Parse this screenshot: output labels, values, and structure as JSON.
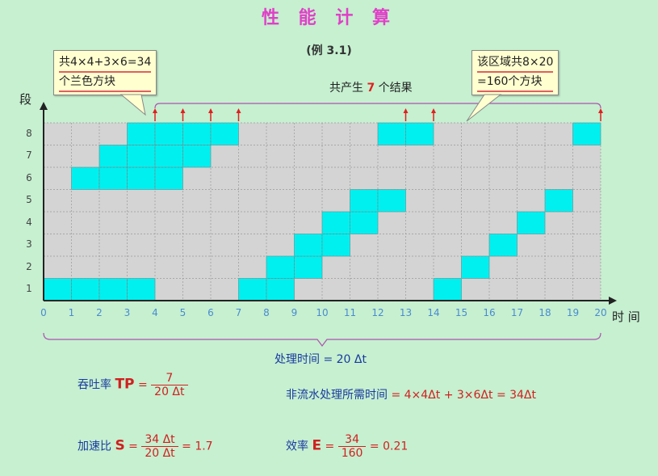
{
  "title": "性 能 计 算",
  "subtitle": "(例 3.1)",
  "callout_left": {
    "line1": "共4×4+3×6=34",
    "line2": "个兰色方块"
  },
  "callout_right": {
    "line1": "该区域共8×20",
    "line2": "=160个方块"
  },
  "results_label": {
    "prefix": "共产生 ",
    "count": "7",
    "suffix": " 个结果"
  },
  "y_axis_label": "段",
  "x_axis_label": "时 间",
  "processing_time": "处理时间 = 20 Δt",
  "colors": {
    "background": "#c6f0d0",
    "block": "#00f0f0",
    "cell": "#d4d4d4",
    "arrow": "#e02020",
    "title": "#e040c8"
  },
  "chart_data": {
    "type": "heatmap",
    "x_ticks": [
      "0",
      "1",
      "2",
      "3",
      "4",
      "5",
      "6",
      "7",
      "8",
      "9",
      "10",
      "11",
      "12",
      "13",
      "14",
      "15",
      "16",
      "17",
      "18",
      "19",
      "20"
    ],
    "y_ticks": [
      "1",
      "2",
      "3",
      "4",
      "5",
      "6",
      "7",
      "8"
    ],
    "blocks": [
      {
        "segment": 1,
        "time": 0
      },
      {
        "segment": 1,
        "time": 1
      },
      {
        "segment": 1,
        "time": 2
      },
      {
        "segment": 1,
        "time": 3
      },
      {
        "segment": 6,
        "time": 1
      },
      {
        "segment": 6,
        "time": 2
      },
      {
        "segment": 6,
        "time": 3
      },
      {
        "segment": 6,
        "time": 4
      },
      {
        "segment": 7,
        "time": 2
      },
      {
        "segment": 7,
        "time": 3
      },
      {
        "segment": 7,
        "time": 4
      },
      {
        "segment": 7,
        "time": 5
      },
      {
        "segment": 8,
        "time": 3
      },
      {
        "segment": 8,
        "time": 4
      },
      {
        "segment": 8,
        "time": 5
      },
      {
        "segment": 8,
        "time": 6
      },
      {
        "segment": 1,
        "time": 7
      },
      {
        "segment": 1,
        "time": 8
      },
      {
        "segment": 2,
        "time": 8
      },
      {
        "segment": 2,
        "time": 9
      },
      {
        "segment": 3,
        "time": 9
      },
      {
        "segment": 3,
        "time": 10
      },
      {
        "segment": 4,
        "time": 10
      },
      {
        "segment": 4,
        "time": 11
      },
      {
        "segment": 5,
        "time": 11
      },
      {
        "segment": 5,
        "time": 12
      },
      {
        "segment": 8,
        "time": 12
      },
      {
        "segment": 8,
        "time": 13
      },
      {
        "segment": 1,
        "time": 14
      },
      {
        "segment": 2,
        "time": 15
      },
      {
        "segment": 3,
        "time": 16
      },
      {
        "segment": 4,
        "time": 17
      },
      {
        "segment": 5,
        "time": 18
      },
      {
        "segment": 8,
        "time": 19
      }
    ],
    "result_arrows_at_time": [
      4,
      5,
      6,
      7,
      13,
      14,
      20
    ]
  },
  "formulas": {
    "throughput": {
      "label": "吞吐率",
      "sym": "TP",
      "num": "7",
      "den": "20 Δt"
    },
    "nonpipeline": {
      "label": "非流水处理所需时间",
      "expr": "= 4×4Δt + 3×6Δt = 34Δt"
    },
    "speedup": {
      "label": "加速比",
      "sym": "S",
      "num": "34 Δt",
      "den": "20 Δt",
      "result": "= 1.7"
    },
    "efficiency": {
      "label": "效率",
      "sym": "E",
      "num": "34",
      "den": "160",
      "result": "= 0.21"
    }
  }
}
